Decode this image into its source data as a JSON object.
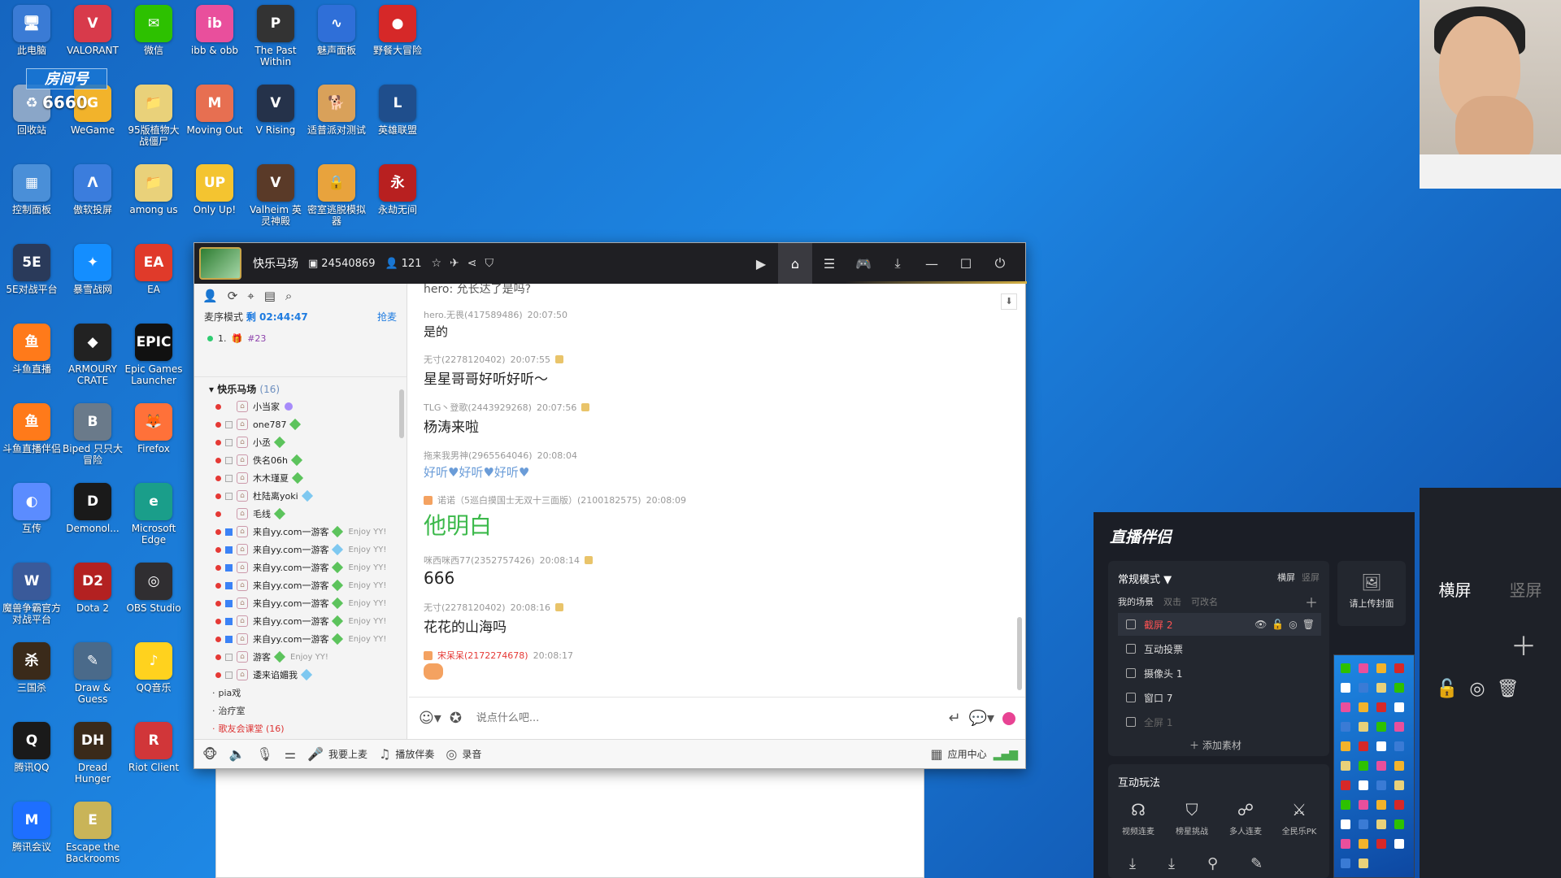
{
  "desktop": {
    "room_badge": "房间号",
    "room_number": "6660",
    "icons": [
      {
        "label": "此电脑",
        "color": "#3a7bd5",
        "glyph": "🖥"
      },
      {
        "label": "VALORANT",
        "color": "#d83a4b",
        "glyph": "V"
      },
      {
        "label": "微信",
        "color": "#2dc100",
        "glyph": "✉"
      },
      {
        "label": "ibb & obb",
        "color": "#e94f9c",
        "glyph": "ib"
      },
      {
        "label": "The Past Within",
        "color": "#333333",
        "glyph": "P"
      },
      {
        "label": "魅声面板",
        "color": "#2f6fd8",
        "glyph": "∿"
      },
      {
        "label": "野餐大冒险",
        "color": "#d62828",
        "glyph": "●"
      },
      {
        "label": "回收站",
        "color": "#8aa6c8",
        "glyph": "♻"
      },
      {
        "label": "WeGame",
        "color": "#f2b32b",
        "glyph": "G"
      },
      {
        "label": "95版植物大战僵尸",
        "color": "#e9d17a",
        "glyph": "📁"
      },
      {
        "label": "Moving Out",
        "color": "#e76f51",
        "glyph": "M"
      },
      {
        "label": "V Rising",
        "color": "#25324a",
        "glyph": "V"
      },
      {
        "label": "适普派对测试",
        "color": "#d9a15a",
        "glyph": "🐕"
      },
      {
        "label": "英雄联盟",
        "color": "#1f4e8c",
        "glyph": "L"
      },
      {
        "label": "控制面板",
        "color": "#4a8fd8",
        "glyph": "▦"
      },
      {
        "label": "傲软投屏",
        "color": "#3b7ddd",
        "glyph": "Λ"
      },
      {
        "label": "among us",
        "color": "#e9d17a",
        "glyph": "📁"
      },
      {
        "label": "Only Up!",
        "color": "#f4c430",
        "glyph": "UP"
      },
      {
        "label": "Valheim 英灵神殿",
        "color": "#5a3a28",
        "glyph": "V"
      },
      {
        "label": "密室逃脱模拟器",
        "color": "#e8a33d",
        "glyph": "🔒"
      },
      {
        "label": "永劫无间",
        "color": "#b82020",
        "glyph": "永"
      },
      {
        "label": "5E对战平台",
        "color": "#2a3a5a",
        "glyph": "5E"
      },
      {
        "label": "暴雪战网",
        "color": "#148eff",
        "glyph": "✦"
      },
      {
        "label": "EA",
        "color": "#e03a2a",
        "glyph": "EA"
      },
      {
        "label": "斗鱼直播",
        "color": "#ff7a1a",
        "glyph": "鱼"
      },
      {
        "label": "ARMOURY CRATE",
        "color": "#222222",
        "glyph": "◆"
      },
      {
        "label": "Epic Games Launcher",
        "color": "#111111",
        "glyph": "EPIC"
      },
      {
        "label": "斗鱼直播伴侣",
        "color": "#ff7a1a",
        "glyph": "鱼"
      },
      {
        "label": "Biped 只只大冒险",
        "color": "#6a7a8a",
        "glyph": "B"
      },
      {
        "label": "Firefox",
        "color": "#ff7139",
        "glyph": "🦊"
      },
      {
        "label": "互传",
        "color": "#5b8cff",
        "glyph": "◐"
      },
      {
        "label": "Demonol...",
        "color": "#1a1a1a",
        "glyph": "D"
      },
      {
        "label": "Microsoft Edge",
        "color": "#1a9e8a",
        "glyph": "e"
      },
      {
        "label": "魔兽争霸官方对战平台",
        "color": "#3a5a9a",
        "glyph": "W"
      },
      {
        "label": "Dota 2",
        "color": "#b32121",
        "glyph": "D2"
      },
      {
        "label": "OBS Studio",
        "color": "#302e31",
        "glyph": "◎"
      },
      {
        "label": "三国杀",
        "color": "#3a2a1a",
        "glyph": "杀"
      },
      {
        "label": "Draw & Guess",
        "color": "#4a6a8a",
        "glyph": "✎"
      },
      {
        "label": "QQ音乐",
        "color": "#ffd21e",
        "glyph": "♪"
      },
      {
        "label": "腾讯QQ",
        "color": "#1a1a1a",
        "glyph": "Q"
      },
      {
        "label": "Dread Hunger",
        "color": "#3a2a1a",
        "glyph": "DH"
      },
      {
        "label": "Riot Client",
        "color": "#d13639",
        "glyph": "R"
      },
      {
        "label": "腾讯会议",
        "color": "#1e6fff",
        "glyph": "M"
      },
      {
        "label": "Escape the Backrooms",
        "color": "#c9b458",
        "glyph": "E"
      }
    ]
  },
  "yy": {
    "channel_name": "快乐马场",
    "channel_id": "24540869",
    "online_count": "121",
    "queue_mode": "麦序模式",
    "queue_time": "剩 02:44:47",
    "queue_grab": "抢麦",
    "queue_item": "1.",
    "queue_item_num": "#23",
    "channel_head": "快乐马场",
    "channel_head_count": "(16)",
    "users": [
      {
        "name": "小当家",
        "ck": "none",
        "gem": "purple",
        "sig": ""
      },
      {
        "name": "one787",
        "ck": "grey",
        "gem": "green",
        "sig": ""
      },
      {
        "name": "小丞",
        "ck": "grey",
        "gem": "green",
        "sig": ""
      },
      {
        "name": "佚名06h",
        "ck": "grey",
        "gem": "green",
        "sig": ""
      },
      {
        "name": "木木瑾夏",
        "ck": "grey",
        "gem": "green",
        "sig": ""
      },
      {
        "name": "杜陆离yoki",
        "ck": "grey",
        "gem": "blue",
        "sig": ""
      },
      {
        "name": "毛线",
        "ck": "none",
        "gem": "green",
        "sig": ""
      },
      {
        "name": "来自yy.com一游客",
        "ck": "blue",
        "gem": "green",
        "sig": "Enjoy YY!"
      },
      {
        "name": "来自yy.com一游客",
        "ck": "blue",
        "gem": "blue",
        "sig": "Enjoy YY!"
      },
      {
        "name": "来自yy.com一游客",
        "ck": "blue",
        "gem": "green",
        "sig": "Enjoy YY!"
      },
      {
        "name": "来自yy.com一游客",
        "ck": "blue",
        "gem": "green",
        "sig": "Enjoy YY!"
      },
      {
        "name": "来自yy.com一游客",
        "ck": "blue",
        "gem": "green",
        "sig": "Enjoy YY!"
      },
      {
        "name": "来自yy.com一游客",
        "ck": "blue",
        "gem": "green",
        "sig": "Enjoy YY!"
      },
      {
        "name": "来自yy.com一游客",
        "ck": "blue",
        "gem": "green",
        "sig": "Enjoy YY!"
      },
      {
        "name": "游客",
        "ck": "grey",
        "gem": "green",
        "sig": "Enjoy YY!"
      },
      {
        "name": "逶来谄媚我",
        "ck": "grey",
        "gem": "blue",
        "sig": ""
      }
    ],
    "sub_channels": [
      "pia戏",
      "治疗室",
      "歌友会课堂 (16)"
    ],
    "chat_top_cut": "hero: 允长达了是吗?",
    "messages": [
      {
        "meta": "hero.无畏(417589486)",
        "time": "20:07:50",
        "text": "是的",
        "style": "sm",
        "badge": false
      },
      {
        "meta": "无寸(2278120402)",
        "time": "20:07:55",
        "text": "星星哥哥好听好听～",
        "style": "",
        "badge": true
      },
      {
        "meta": "TLG丶登歌(2443929268)",
        "time": "20:07:56",
        "text": "杨涛来啦",
        "style": "",
        "badge": true
      },
      {
        "meta": "拖来我男神(2965564046)",
        "time": "20:08:04",
        "text": "好听♥好听♥好听♥",
        "style": "blue",
        "badge": false
      },
      {
        "meta": "诺诺（5巡白摸国士无双十三面版）(2100182575)",
        "time": "20:08:09",
        "text": "他明白",
        "style": "big-green",
        "badge": false
      },
      {
        "meta": "咪西咪西77(2352757426)",
        "time": "20:08:14",
        "text": "666",
        "style": "num",
        "badge": true
      },
      {
        "meta": "无寸(2278120402)",
        "time": "20:08:16",
        "text": "花花的山海吗",
        "style": "",
        "badge": true
      },
      {
        "meta": "宋呆呆(2172274678)",
        "time": "20:08:17",
        "text": "",
        "style": "emoji",
        "badge": false
      }
    ],
    "input_placeholder": "说点什么吧...",
    "bottom": {
      "mic_on": "我要上麦",
      "accompany": "播放伴奏",
      "record": "录音",
      "app_center": "应用中心"
    }
  },
  "live": {
    "brand": "直播伴侣",
    "mode": "常规模式 ▼",
    "landscape": "横屏",
    "portrait": "竖屏",
    "scene_tabs": [
      "我的场景",
      "双击",
      "可改名"
    ],
    "sources": [
      {
        "label": "截屏 2",
        "sel": true
      },
      {
        "label": "互动投票",
        "sel": false
      },
      {
        "label": "摄像头 1",
        "sel": false
      },
      {
        "label": "窗口 7",
        "sel": false
      },
      {
        "label": "全屏 1",
        "sel": false
      }
    ],
    "add_material": "＋ 添加素材",
    "cover": "请上传封面",
    "interact_head": "互动玩法",
    "interact_items": [
      "视频连麦",
      "榜星挑战",
      "多人连麦",
      "全民乐PK"
    ]
  },
  "right_dark": {
    "landscape": "横屏",
    "portrait": "竖屏"
  }
}
